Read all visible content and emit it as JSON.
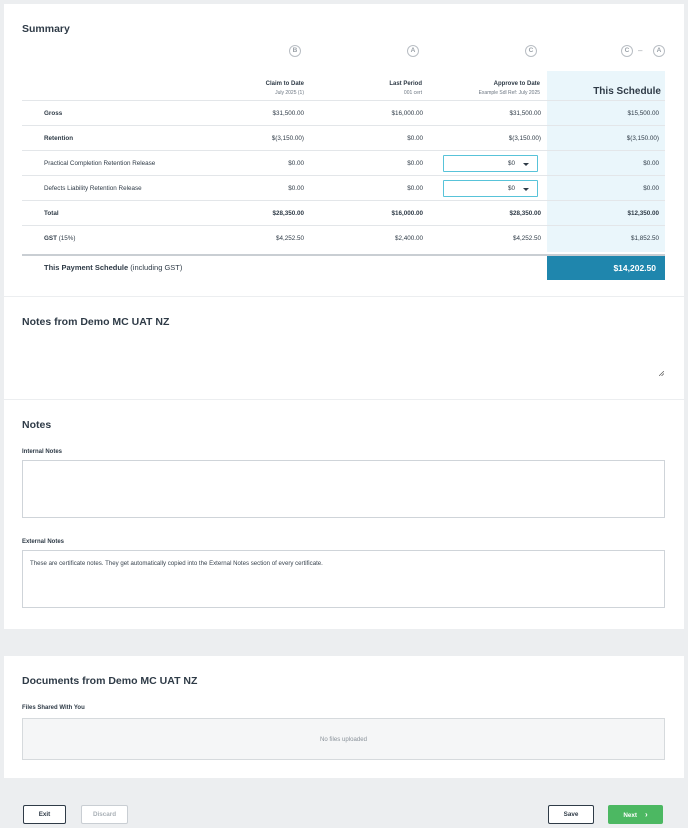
{
  "summary": {
    "title": "Summary",
    "markers": {
      "claim": "B",
      "last": "A",
      "approve": "C",
      "schedule_a": "C",
      "schedule_dash": "–",
      "schedule_b": "A"
    },
    "columns": {
      "claim_to_date": "Claim to Date",
      "claim_sub": "July 2025 (1)",
      "last_period": "Last Period",
      "last_sub": "001 cert",
      "approve_to_date": "Approve to Date",
      "approve_sub": "Example Sdl Ref: July 2025",
      "this_schedule": "This Schedule"
    },
    "rows": [
      {
        "label": "Gross",
        "claim": "$31,500.00",
        "last": "$16,000.00",
        "approve": "$31,500.00",
        "schedule": "$15,500.00"
      },
      {
        "label": "Retention",
        "claim": "$(3,150.00)",
        "last": "$0.00",
        "approve": "$(3,150.00)",
        "schedule": "$(3,150.00)"
      },
      {
        "label": "Practical Completion Retention Release",
        "claim": "$0.00",
        "last": "$0.00",
        "approve_select": "$0",
        "schedule": "$0.00"
      },
      {
        "label": "Defects Liability Retention Release",
        "claim": "$0.00",
        "last": "$0.00",
        "approve_select": "$0",
        "schedule": "$0.00"
      },
      {
        "label": "Total",
        "claim": "$28,350.00",
        "last": "$16,000.00",
        "approve": "$28,350.00",
        "schedule": "$12,350.00"
      },
      {
        "label_bold": "GST",
        "label_rest": " (15%)",
        "claim": "$4,252.50",
        "last": "$2,400.00",
        "approve": "$4,252.50",
        "schedule": "$1,852.50"
      }
    ],
    "payment": {
      "label_bold": "This Payment Schedule",
      "label_rest": " (including GST)",
      "amount": "$14,202.50"
    }
  },
  "notes_from": {
    "title": "Notes from Demo MC UAT NZ"
  },
  "notes": {
    "title": "Notes",
    "internal_label": "Internal Notes",
    "internal_value": "",
    "external_label": "External Notes",
    "external_value": "These are certificate notes. They get automatically copied into the External Notes section of every certificate."
  },
  "documents": {
    "title": "Documents from Demo MC UAT NZ",
    "files_label": "Files Shared With You",
    "empty_text": "No files uploaded"
  },
  "footer": {
    "exit": "Exit",
    "discard": "Discard",
    "save": "Save",
    "next": "Next",
    "next_icon": "›"
  },
  "colors": {
    "accent": "#1f86ad",
    "success": "#4cb862",
    "highlight": "#eaf6fb",
    "select_border": "#58c3d9"
  }
}
